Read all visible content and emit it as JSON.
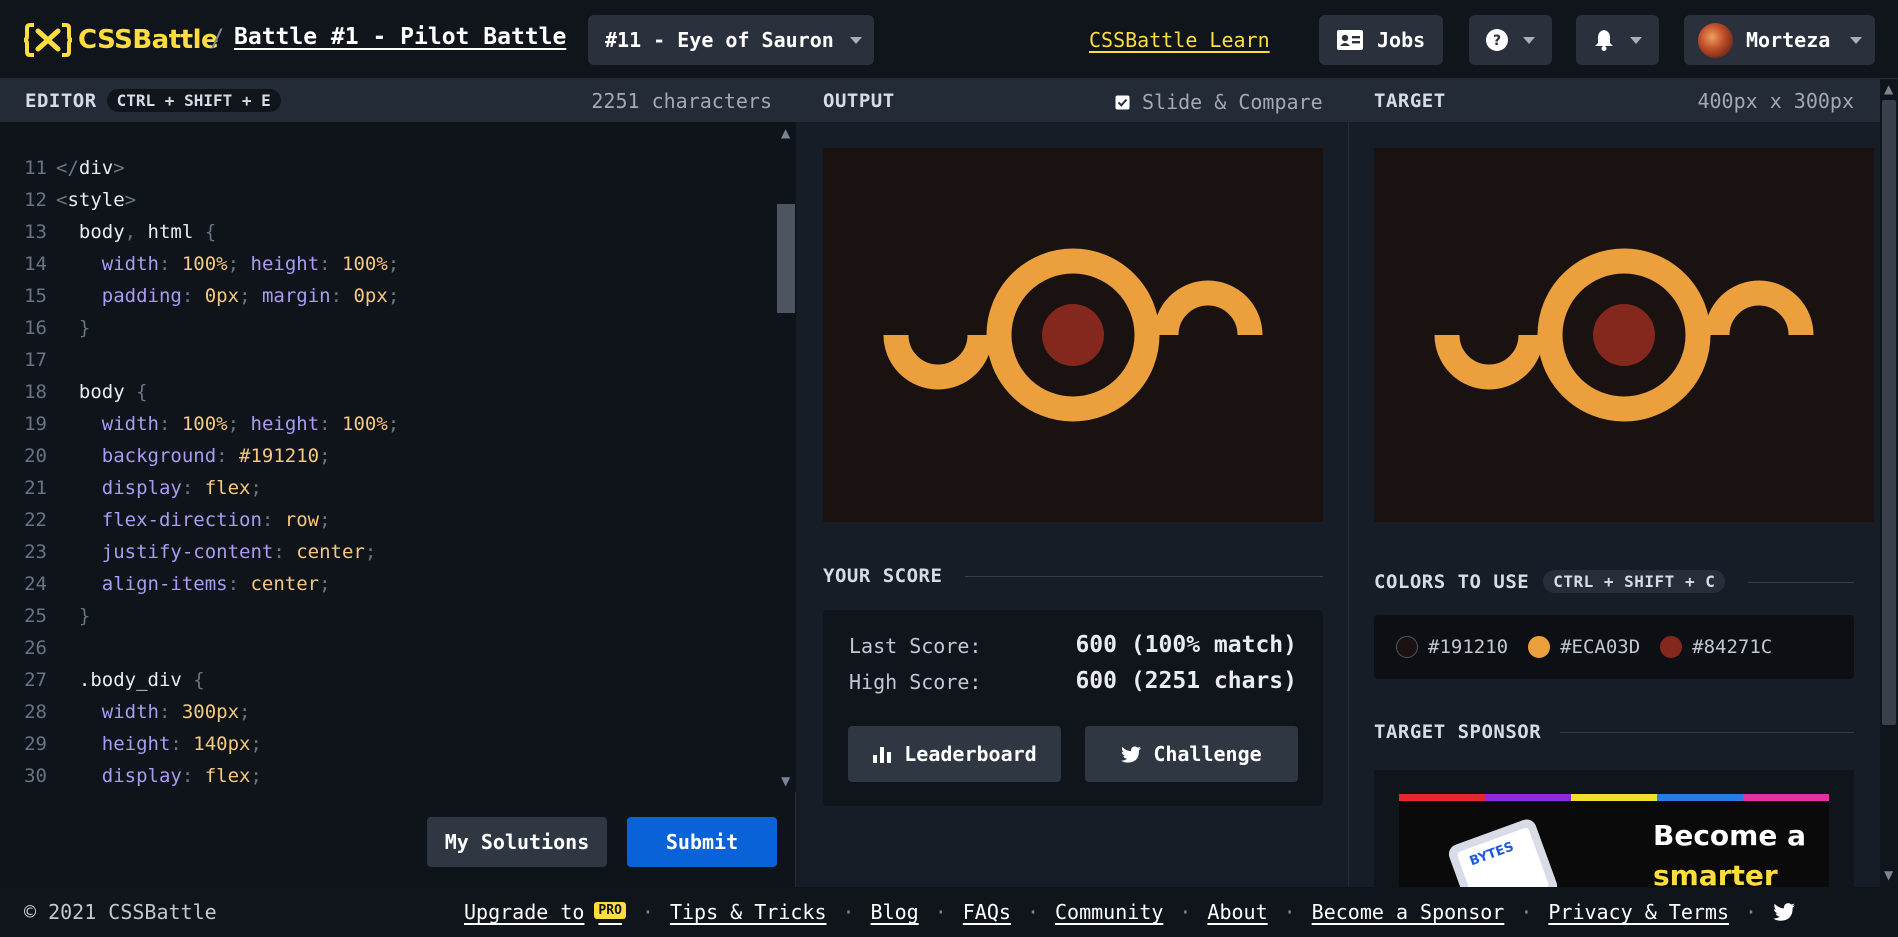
{
  "header": {
    "logo_text": "CSSBattle",
    "crumb_separator": "/",
    "battle_title": "Battle #1 - Pilot Battle",
    "target_selector": "#11 - Eye of Sauron",
    "learn_link": "CSSBattle Learn",
    "jobs_label": "Jobs",
    "user_name": "Morteza"
  },
  "editor": {
    "label": "EDITOR",
    "shortcut": "CTRL + SHIFT + E",
    "char_count": "2251 characters",
    "lines": [
      {
        "n": "11",
        "tokens": [
          [
            "t-punc",
            "</"
          ],
          [
            "t-tag",
            "div"
          ],
          [
            "t-punc",
            ">"
          ]
        ]
      },
      {
        "n": "12",
        "tokens": [
          [
            "t-punc",
            "<"
          ],
          [
            "t-tag",
            "style"
          ],
          [
            "t-punc",
            ">"
          ]
        ]
      },
      {
        "n": "13",
        "tokens": [
          [
            "tx",
            "  body"
          ],
          [
            "t-punc",
            ", "
          ],
          [
            "tx",
            "html "
          ],
          [
            "t-punc",
            "{"
          ]
        ]
      },
      {
        "n": "14",
        "tokens": [
          [
            "t-prop",
            "    width"
          ],
          [
            "t-punc",
            ": "
          ],
          [
            "t-val",
            "100%"
          ],
          [
            "t-punc",
            "; "
          ],
          [
            "t-prop",
            "height"
          ],
          [
            "t-punc",
            ": "
          ],
          [
            "t-val",
            "100%"
          ],
          [
            "t-punc",
            ";"
          ]
        ]
      },
      {
        "n": "15",
        "tokens": [
          [
            "t-prop",
            "    padding"
          ],
          [
            "t-punc",
            ": "
          ],
          [
            "t-val",
            "0px"
          ],
          [
            "t-punc",
            "; "
          ],
          [
            "t-prop",
            "margin"
          ],
          [
            "t-punc",
            ": "
          ],
          [
            "t-val",
            "0px"
          ],
          [
            "t-punc",
            ";"
          ]
        ]
      },
      {
        "n": "16",
        "tokens": [
          [
            "t-punc",
            "  }"
          ]
        ]
      },
      {
        "n": "17",
        "tokens": []
      },
      {
        "n": "18",
        "tokens": [
          [
            "tx",
            "  body "
          ],
          [
            "t-punc",
            "{"
          ]
        ]
      },
      {
        "n": "19",
        "tokens": [
          [
            "t-prop",
            "    width"
          ],
          [
            "t-punc",
            ": "
          ],
          [
            "t-val",
            "100%"
          ],
          [
            "t-punc",
            "; "
          ],
          [
            "t-prop",
            "height"
          ],
          [
            "t-punc",
            ": "
          ],
          [
            "t-val",
            "100%"
          ],
          [
            "t-punc",
            ";"
          ]
        ]
      },
      {
        "n": "20",
        "tokens": [
          [
            "t-prop",
            "    background"
          ],
          [
            "t-punc",
            ": "
          ],
          [
            "t-val",
            "#191210"
          ],
          [
            "t-punc",
            ";"
          ]
        ]
      },
      {
        "n": "21",
        "tokens": [
          [
            "t-prop",
            "    display"
          ],
          [
            "t-punc",
            ": "
          ],
          [
            "t-val",
            "flex"
          ],
          [
            "t-punc",
            ";"
          ]
        ]
      },
      {
        "n": "22",
        "tokens": [
          [
            "t-prop",
            "    flex-direction"
          ],
          [
            "t-punc",
            ": "
          ],
          [
            "t-val",
            "row"
          ],
          [
            "t-punc",
            ";"
          ]
        ]
      },
      {
        "n": "23",
        "tokens": [
          [
            "t-prop",
            "    justify-content"
          ],
          [
            "t-punc",
            ": "
          ],
          [
            "t-val",
            "center"
          ],
          [
            "t-punc",
            ";"
          ]
        ]
      },
      {
        "n": "24",
        "tokens": [
          [
            "t-prop",
            "    align-items"
          ],
          [
            "t-punc",
            ": "
          ],
          [
            "t-val",
            "center"
          ],
          [
            "t-punc",
            ";"
          ]
        ]
      },
      {
        "n": "25",
        "tokens": [
          [
            "t-punc",
            "  }"
          ]
        ]
      },
      {
        "n": "26",
        "tokens": []
      },
      {
        "n": "27",
        "tokens": [
          [
            "tx",
            "  .body_div "
          ],
          [
            "t-punc",
            "{"
          ]
        ]
      },
      {
        "n": "28",
        "tokens": [
          [
            "t-prop",
            "    width"
          ],
          [
            "t-punc",
            ": "
          ],
          [
            "t-val",
            "300px"
          ],
          [
            "t-punc",
            ";"
          ]
        ]
      },
      {
        "n": "29",
        "tokens": [
          [
            "t-prop",
            "    height"
          ],
          [
            "t-punc",
            ": "
          ],
          [
            "t-val",
            "140px"
          ],
          [
            "t-punc",
            ";"
          ]
        ]
      },
      {
        "n": "30",
        "tokens": [
          [
            "t-prop",
            "    display"
          ],
          [
            "t-punc",
            ": "
          ],
          [
            "t-val",
            "flex"
          ],
          [
            "t-punc",
            ";"
          ]
        ]
      }
    ],
    "my_solutions_label": "My Solutions",
    "submit_label": "Submit"
  },
  "output": {
    "label": "OUTPUT",
    "slide_compare_label": "Slide & Compare",
    "slide_compare_checked": true
  },
  "score": {
    "title": "YOUR SCORE",
    "last_label": "Last Score:",
    "last_value": "600 (100% match)",
    "high_label": "High Score:",
    "high_value": "600 (2251 chars)",
    "leaderboard_label": "Leaderboard",
    "challenge_label": "Challenge"
  },
  "target": {
    "label": "TARGET",
    "size": "400px x 300px",
    "colors_title": "COLORS TO USE",
    "colors_shortcut": "CTRL + SHIFT + C",
    "colors": [
      {
        "hex": "#191210",
        "label": "#191210"
      },
      {
        "hex": "#ECA03D",
        "label": "#ECA03D"
      },
      {
        "hex": "#84271C",
        "label": "#84271C"
      }
    ],
    "sponsor_title": "TARGET SPONSOR",
    "sponsor_brand": "BYTES",
    "sponsor_line1": "Become a",
    "sponsor_line2": "smarter"
  },
  "footer": {
    "copyright": "© 2021 CSSBattle",
    "separator": "·",
    "upgrade": "Upgrade to",
    "pro_badge": "PRO",
    "tips": "Tips & Tricks",
    "blog": "Blog",
    "faqs": "FAQs",
    "community": "Community",
    "about": "About",
    "sponsor": "Become a Sponsor",
    "privacy": "Privacy & Terms"
  },
  "colors": {
    "accent_yellow": "#ffdd40",
    "submit_blue": "#0a62d8",
    "canvas_bg": "#191210",
    "shape_orange": "#ECA03D",
    "shape_red": "#84271C"
  },
  "icons": [
    "logo-icon",
    "id-card-icon",
    "question-icon",
    "bell-icon",
    "avatar",
    "checkbox-icon",
    "bar-chart-icon",
    "twitter-icon",
    "chevron-down-icon"
  ]
}
